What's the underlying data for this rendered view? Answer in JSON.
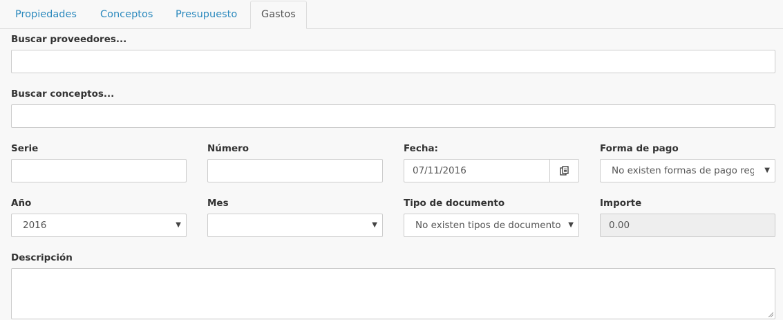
{
  "tabs": [
    {
      "label": "Propiedades"
    },
    {
      "label": "Conceptos"
    },
    {
      "label": "Presupuesto"
    },
    {
      "label": "Gastos"
    }
  ],
  "form": {
    "proveedores_label": "Buscar proveedores...",
    "proveedores_value": "",
    "conceptos_label": "Buscar conceptos...",
    "conceptos_value": "",
    "serie_label": "Serie",
    "serie_value": "",
    "numero_label": "Número",
    "numero_value": "",
    "fecha_label": "Fecha:",
    "fecha_value": "07/11/2016",
    "forma_pago_label": "Forma de pago",
    "forma_pago_value": "No existen formas de pago registradas",
    "anio_label": "Año",
    "anio_value": "2016",
    "mes_label": "Mes",
    "mes_value": "",
    "tipo_doc_label": "Tipo de documento",
    "tipo_doc_value": "No existen tipos de documento",
    "importe_label": "Importe",
    "importe_value": "0.00",
    "descripcion_label": "Descripción",
    "descripcion_value": ""
  },
  "colors": {
    "tab_link": "#2b89bd",
    "background": "#f8f8f8",
    "border": "#cccccc",
    "disabled": "#eeeeee"
  },
  "icons": {
    "calendar_button": "copy-calendar-icon",
    "select_caret": "caret-down-icon"
  }
}
